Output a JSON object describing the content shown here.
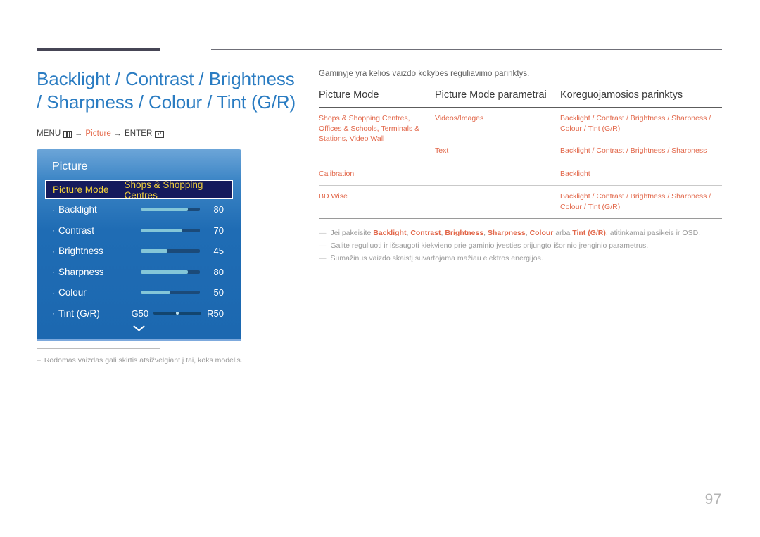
{
  "page": {
    "title": "Backlight / Contrast / Brightness\n/ Sharpness / Colour / Tint (G/R)",
    "number": "97",
    "title_color": "#2a7cc2",
    "accent_color": "#e2684b"
  },
  "menu_path": {
    "menu_label": "MENU",
    "menu_icon": "menu-grid-icon",
    "arrow1": "→",
    "node": "Picture",
    "arrow2": "→",
    "enter_label": "ENTER",
    "enter_icon": "enter-key-icon"
  },
  "osd": {
    "title": "Picture",
    "selected_row": {
      "label": "Picture Mode",
      "value": "Shops & Shopping Centres"
    },
    "rows": [
      {
        "bullet": "·",
        "label": "Backlight",
        "value": "80",
        "fill_pct": 80
      },
      {
        "bullet": "·",
        "label": "Contrast",
        "value": "70",
        "fill_pct": 70
      },
      {
        "bullet": "·",
        "label": "Brightness",
        "value": "45",
        "fill_pct": 45
      },
      {
        "bullet": "·",
        "label": "Sharpness",
        "value": "80",
        "fill_pct": 80
      },
      {
        "bullet": "·",
        "label": "Colour",
        "value": "50",
        "fill_pct": 50
      }
    ],
    "tint_row": {
      "bullet": "·",
      "label": "Tint (G/R)",
      "left_value": "G50",
      "right_value": "R50"
    },
    "scroll_hint": "chevron-down-icon"
  },
  "left_note": {
    "dash": "–",
    "text": "Rodomas vaizdas gali skirtis atsižvelgiant į tai, koks modelis."
  },
  "right": {
    "intro": "Gaminyje yra kelios vaizdo kokybės reguliavimo parinktys.",
    "table": {
      "headers": [
        "Picture Mode",
        "Picture Mode parametrai",
        "Koreguojamosios parinktys"
      ],
      "rows": [
        {
          "mode": "Shops & Shopping Centres, Offices & Schools,  Terminals & Stations, Video Wall",
          "param": "Videos/Images",
          "adjustable": "Backlight / Contrast / Brightness / Sharpness / Colour / Tint (G/R)",
          "rowspan": 2
        },
        {
          "mode": "",
          "param": "Text",
          "adjustable": "Backlight / Contrast / Brightness / Sharpness"
        },
        {
          "mode": "Calibration",
          "param": "",
          "adjustable": "Backlight"
        },
        {
          "mode": "BD Wise",
          "param": "",
          "adjustable": "Backlight / Contrast / Brightness / Sharpness / Colour / Tint (G/R)"
        }
      ]
    },
    "notes": [
      {
        "dash": "—",
        "parts": [
          {
            "t": "Jei pakeisite ",
            "hl": false
          },
          {
            "t": "Backlight",
            "hl": true
          },
          {
            "t": ", ",
            "hl": false
          },
          {
            "t": "Contrast",
            "hl": true
          },
          {
            "t": ", ",
            "hl": false
          },
          {
            "t": "Brightness",
            "hl": true
          },
          {
            "t": ", ",
            "hl": false
          },
          {
            "t": "Sharpness",
            "hl": true
          },
          {
            "t": ", ",
            "hl": false
          },
          {
            "t": "Colour",
            "hl": true
          },
          {
            "t": " arba ",
            "hl": false
          },
          {
            "t": "Tint (G/R)",
            "hl": true
          },
          {
            "t": ", atitinkamai pasikeis ir OSD.",
            "hl": false
          }
        ],
        "plain": "Jei pakeisite Backlight, Contrast, Brightness, Sharpness, Colour arba Tint (G/R), atitinkamai pasikeis ir OSD."
      },
      {
        "dash": "—",
        "plain": "Galite reguliuoti ir išsaugoti kiekvieno prie gaminio įvesties prijungto išorinio įrenginio parametrus."
      },
      {
        "dash": "—",
        "plain": "Sumažinus vaizdo skaistį suvartojama mažiau elektros energijos."
      }
    ]
  }
}
